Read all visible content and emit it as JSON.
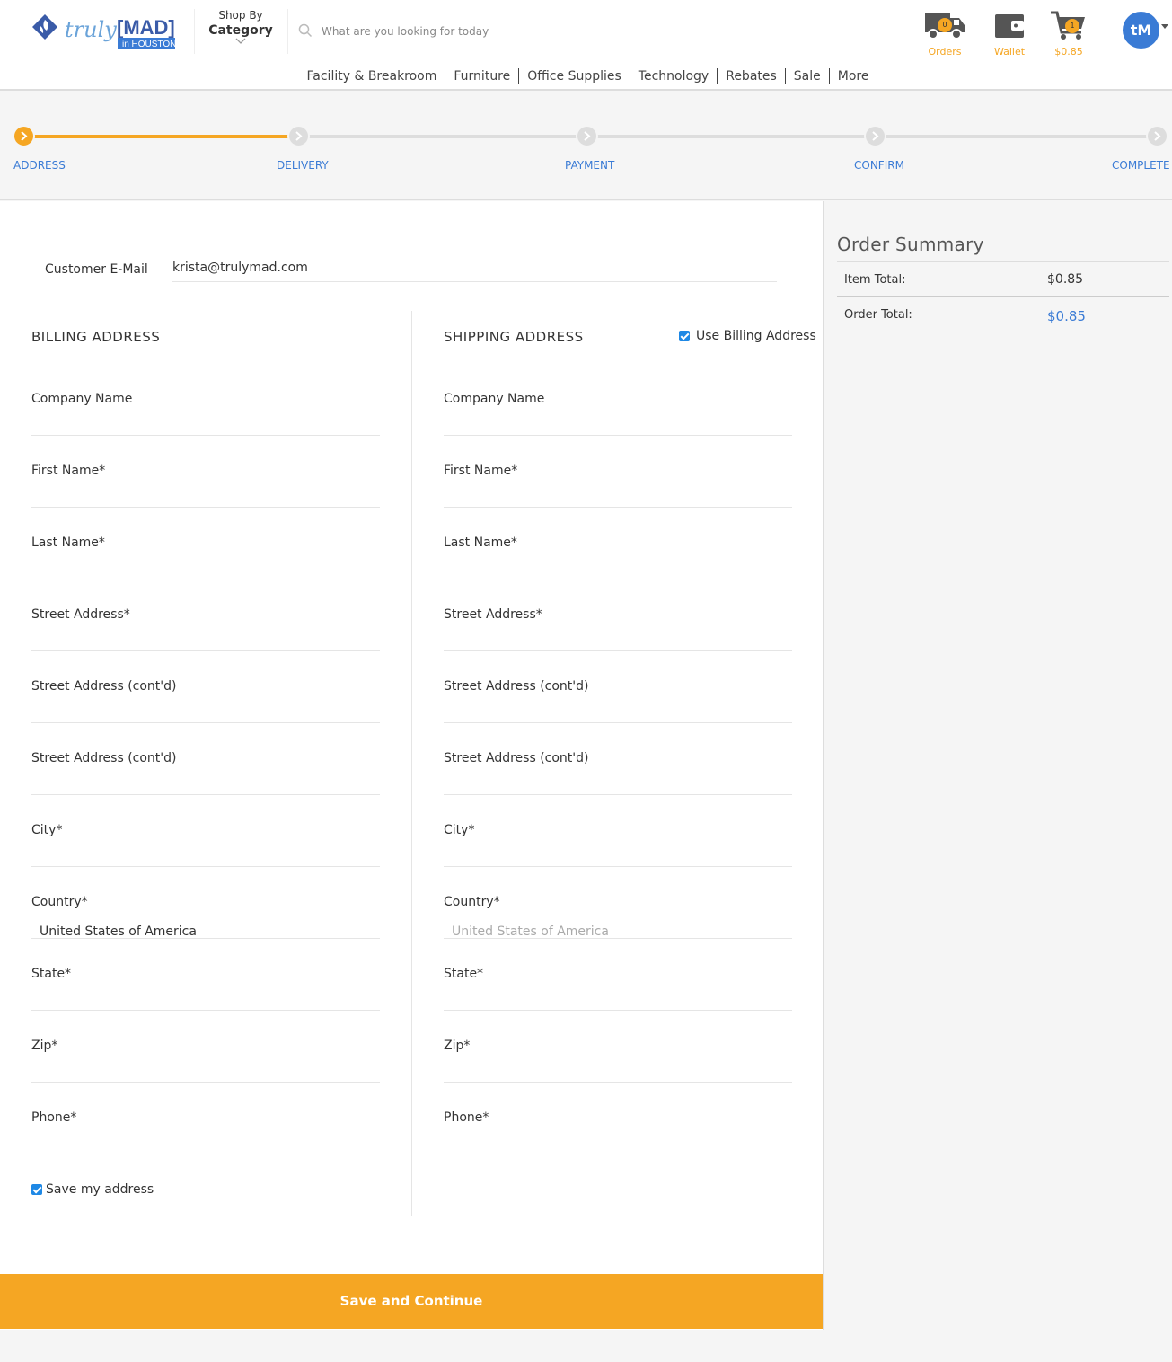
{
  "header": {
    "logo": {
      "word": "truly",
      "brand": "[MAD]",
      "sub": "in HOUSTON"
    },
    "shop_by": {
      "line1": "Shop By",
      "line2": "Category"
    },
    "search": {
      "placeholder": "What are you looking for today"
    },
    "orders": {
      "label": "Orders",
      "badge": "0"
    },
    "wallet": {
      "label": "Wallet"
    },
    "cart": {
      "label": "$0.85",
      "badge": "1"
    },
    "avatar": {
      "initials": "tM"
    },
    "nav": [
      "Facility & Breakroom",
      "Furniture",
      "Office Supplies",
      "Technology",
      "Rebates",
      "Sale",
      "More"
    ],
    "accent_color": "#f5a623",
    "link_color": "#3a7bd5"
  },
  "steps": {
    "items": [
      "ADDRESS",
      "DELIVERY",
      "PAYMENT",
      "CONFIRM",
      "COMPLETE"
    ],
    "active_index": 0
  },
  "form": {
    "email_label": "Customer E-Mail",
    "email_value": "krista@trulymad.com",
    "billing": {
      "title": "BILLING ADDRESS",
      "fields": [
        {
          "label": "Company Name",
          "value": ""
        },
        {
          "label": "First Name*",
          "value": ""
        },
        {
          "label": "Last Name*",
          "value": ""
        },
        {
          "label": "Street Address*",
          "value": ""
        },
        {
          "label": "Street Address (cont'd)",
          "value": ""
        },
        {
          "label": "Street Address (cont'd)",
          "value": ""
        },
        {
          "label": "City*",
          "value": ""
        },
        {
          "label": "Country*",
          "value": "United States of America"
        },
        {
          "label": "State*",
          "value": ""
        },
        {
          "label": "Zip*",
          "value": ""
        },
        {
          "label": "Phone*",
          "value": ""
        }
      ],
      "save_label": "Save my address",
      "save_checked": true
    },
    "shipping": {
      "title": "SHIPPING ADDRESS",
      "use_billing_label": "Use Billing Address",
      "use_billing_checked": true,
      "fields": [
        {
          "label": "Company Name",
          "value": ""
        },
        {
          "label": "First Name*",
          "value": ""
        },
        {
          "label": "Last Name*",
          "value": ""
        },
        {
          "label": "Street Address*",
          "value": ""
        },
        {
          "label": "Street Address (cont'd)",
          "value": ""
        },
        {
          "label": "Street Address (cont'd)",
          "value": ""
        },
        {
          "label": "City*",
          "value": ""
        },
        {
          "label": "Country*",
          "value": "United States of America"
        },
        {
          "label": "State*",
          "value": ""
        },
        {
          "label": "Zip*",
          "value": ""
        },
        {
          "label": "Phone*",
          "value": ""
        }
      ]
    },
    "submit_label": "Save and Continue"
  },
  "summary": {
    "title": "Order Summary",
    "item_total_label": "Item Total:",
    "item_total_value": "$0.85",
    "order_total_label": "Order Total:",
    "order_total_value": "$0.85"
  }
}
